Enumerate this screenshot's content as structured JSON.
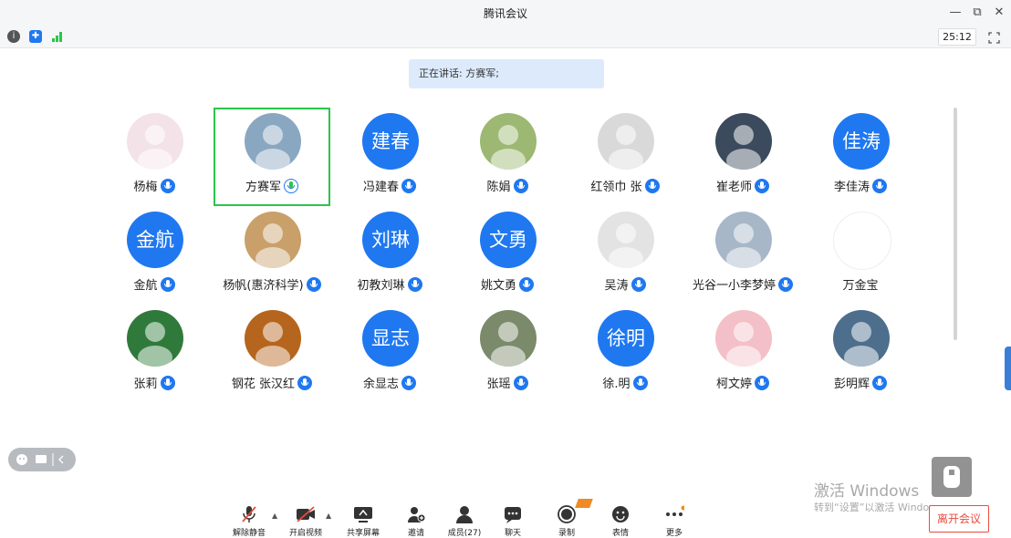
{
  "window": {
    "title": "腾讯会议",
    "minimize": "—",
    "restore": "⧉",
    "close": "✕"
  },
  "toolbar": {
    "timer": "25:12"
  },
  "speaking_banner": "正在讲话: 方赛军;",
  "participants": [
    {
      "name": "杨梅",
      "avatar_text": "",
      "avatar_color": "#f3e3e8"
    },
    {
      "name": "方赛军",
      "avatar_text": "",
      "avatar_color": "#8aa7c2"
    },
    {
      "name": "冯建春",
      "avatar_text": "建春",
      "avatar_color": "#1f78f0"
    },
    {
      "name": "陈娟",
      "avatar_text": "",
      "avatar_color": "#9cb872"
    },
    {
      "name": "红领巾 张",
      "avatar_text": "",
      "avatar_color": "#d9d9d9"
    },
    {
      "name": "崔老师",
      "avatar_text": "",
      "avatar_color": "#3b4a5c"
    },
    {
      "name": "李佳涛",
      "avatar_text": "佳涛",
      "avatar_color": "#1f78f0"
    },
    {
      "name": "金航",
      "avatar_text": "金航",
      "avatar_color": "#1f78f0"
    },
    {
      "name": "杨帆(惠济科学)",
      "avatar_text": "",
      "avatar_color": "#c9a06a"
    },
    {
      "name": "初教刘琳",
      "avatar_text": "刘琳",
      "avatar_color": "#1f78f0"
    },
    {
      "name": "姚文勇",
      "avatar_text": "文勇",
      "avatar_color": "#1f78f0"
    },
    {
      "name": "吴涛",
      "avatar_text": "",
      "avatar_color": "#e3e3e3"
    },
    {
      "name": "光谷一小李梦婷",
      "avatar_text": "",
      "avatar_color": "#a7b7c8"
    },
    {
      "name": "万金宝",
      "avatar_text": "",
      "avatar_color": "#ffffff"
    },
    {
      "name": "张莉",
      "avatar_text": "",
      "avatar_color": "#2f7a3a"
    },
    {
      "name": "钢花 张汉红",
      "avatar_text": "",
      "avatar_color": "#b5651d"
    },
    {
      "name": "余显志",
      "avatar_text": "显志",
      "avatar_color": "#1f78f0"
    },
    {
      "name": "张瑶",
      "avatar_text": "",
      "avatar_color": "#7a8a6a"
    },
    {
      "name": "徐.明",
      "avatar_text": "徐明",
      "avatar_color": "#1f78f0"
    },
    {
      "name": "柯文婷",
      "avatar_text": "",
      "avatar_color": "#f4c0c8"
    },
    {
      "name": "彭明辉",
      "avatar_text": "",
      "avatar_color": "#4d6e8c"
    }
  ],
  "bottom_bar": [
    {
      "label": "解除静音",
      "icon": "mic-muted-icon"
    },
    {
      "label": "开启视频",
      "icon": "video-off-icon"
    },
    {
      "label": "共享屏幕",
      "icon": "share-screen-icon"
    },
    {
      "label": "邀请",
      "icon": "invite-icon"
    },
    {
      "label": "成员(27)",
      "icon": "members-icon"
    },
    {
      "label": "聊天",
      "icon": "chat-icon"
    },
    {
      "label": "录制",
      "icon": "record-icon"
    },
    {
      "label": "表情",
      "icon": "emoji-icon"
    },
    {
      "label": "更多",
      "icon": "more-icon"
    }
  ],
  "leave_button": "离开会议",
  "watermark": {
    "line1": "激活 Windows",
    "line2": "转到“设置”以激活 Windows。"
  },
  "colors": {
    "accent": "#1f78f0",
    "active_border": "#2bc44b",
    "leave": "#e84c3d"
  }
}
